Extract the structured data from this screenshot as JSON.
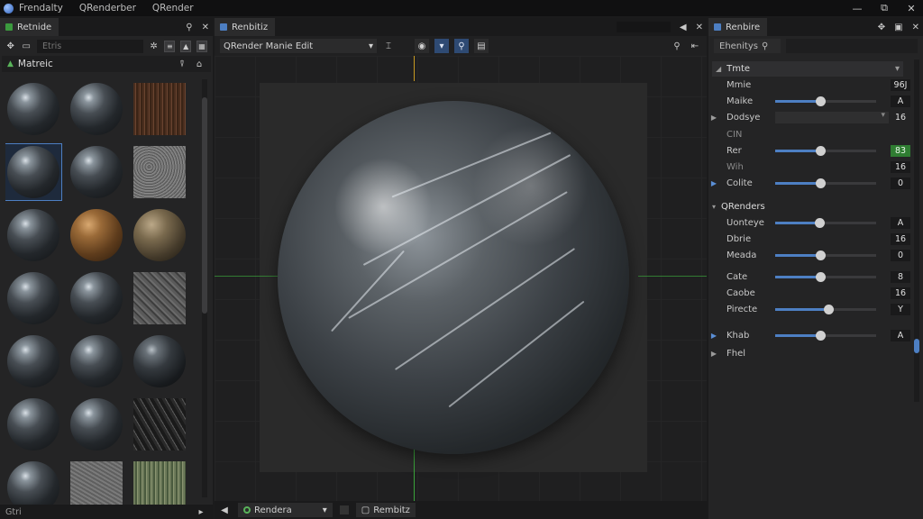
{
  "titlebar": {
    "menu": [
      "Frendalty",
      "QRenderber",
      "QRender"
    ]
  },
  "left_panel": {
    "tab_title": "Retnide",
    "search_placeholder": "Etris",
    "section_title": "Matreic",
    "bottom_label": "Gtri",
    "thumbnails": [
      {
        "kind": "sphere"
      },
      {
        "kind": "sphere"
      },
      {
        "kind": "bark"
      },
      {
        "kind": "sphere",
        "selected": true
      },
      {
        "kind": "sphere"
      },
      {
        "kind": "noise"
      },
      {
        "kind": "sphere"
      },
      {
        "kind": "rust"
      },
      {
        "kind": "rock"
      },
      {
        "kind": "sphere"
      },
      {
        "kind": "sphere"
      },
      {
        "kind": "stone"
      },
      {
        "kind": "sphere"
      },
      {
        "kind": "sphere"
      },
      {
        "kind": "dark"
      },
      {
        "kind": "sphere"
      },
      {
        "kind": "sphere"
      },
      {
        "kind": "scratch"
      },
      {
        "kind": "sphere"
      },
      {
        "kind": "gray"
      },
      {
        "kind": "mossy"
      }
    ]
  },
  "center_panel": {
    "tab_title": "Renbitiz",
    "mode_select": "QRender Manie Edit",
    "bottom_tabs": [
      "Rendera",
      "Rembitz"
    ]
  },
  "right_panel": {
    "tab_title": "Renbire",
    "search_label": "Ehenitys",
    "group_title": "Tmte",
    "group2_title": "QRenders",
    "properties": [
      {
        "label": "Mmie",
        "value": "96J",
        "type": "value"
      },
      {
        "label": "Maike",
        "value": "A",
        "type": "slider",
        "level": 0.45
      },
      {
        "label": "Dodsye",
        "value": "16",
        "type": "dropdown",
        "arrow": "gray"
      },
      {
        "label": "CIN",
        "type": "label",
        "dim": true
      },
      {
        "label": "Rer",
        "value": "83",
        "type": "slider",
        "level": 0.45,
        "green": true
      },
      {
        "label": "Wih",
        "value": "16",
        "type": "value",
        "dim": true
      },
      {
        "label": "Colite",
        "value": "0",
        "type": "slider",
        "level": 0.45,
        "arrow": "blue"
      },
      {
        "label": "Uonteye",
        "value": "A",
        "type": "slider",
        "level": 0.44
      },
      {
        "label": "Dbrie",
        "value": "16",
        "type": "value"
      },
      {
        "label": "Meada",
        "value": "0",
        "type": "slider",
        "level": 0.45
      },
      {
        "label": "Cate",
        "value": "8",
        "type": "slider",
        "level": 0.45
      },
      {
        "label": "Caobe",
        "value": "16",
        "type": "value"
      },
      {
        "label": "Pirecte",
        "value": "Y",
        "type": "slider",
        "level": 0.53
      },
      {
        "label": "Khab",
        "value": "A",
        "type": "slider",
        "level": 0.45,
        "arrow": "blue"
      },
      {
        "label": "Fhel",
        "type": "label",
        "arrow": "gray"
      }
    ]
  },
  "colors": {
    "accent": "#4d7fc3",
    "green": "#2f7d32"
  }
}
